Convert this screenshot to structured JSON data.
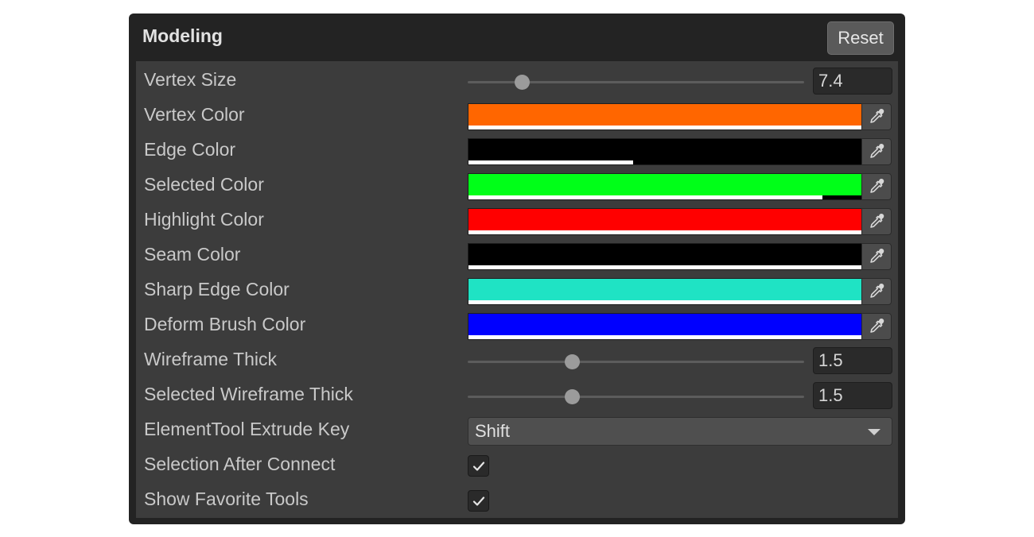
{
  "panel": {
    "title": "Modeling",
    "reset_label": "Reset"
  },
  "rows": [
    {
      "type": "slider",
      "label": "Vertex Size",
      "value": "7.4",
      "slider_fraction": 0.16
    },
    {
      "type": "color",
      "label": "Vertex Color",
      "color": "#ff6600",
      "alpha_fraction": 1.0
    },
    {
      "type": "color",
      "label": "Edge Color",
      "color": "#000000",
      "alpha_fraction": 0.42
    },
    {
      "type": "color",
      "label": "Selected Color",
      "color": "#00ff18",
      "alpha_fraction": 0.9
    },
    {
      "type": "color",
      "label": "Highlight Color",
      "color": "#ff0000",
      "alpha_fraction": 1.0
    },
    {
      "type": "color",
      "label": "Seam Color",
      "color": "#000000",
      "alpha_fraction": 1.0
    },
    {
      "type": "color",
      "label": "Sharp Edge Color",
      "color": "#1fe3c4",
      "alpha_fraction": 1.0
    },
    {
      "type": "color",
      "label": "Deform Brush Color",
      "color": "#0000ff",
      "alpha_fraction": 1.0
    },
    {
      "type": "slider",
      "label": "Wireframe Thick",
      "value": "1.5",
      "slider_fraction": 0.31
    },
    {
      "type": "slider",
      "label": "Selected Wireframe Thick",
      "value": "1.5",
      "slider_fraction": 0.31
    },
    {
      "type": "dropdown",
      "label": "ElementTool Extrude Key",
      "value": "Shift"
    },
    {
      "type": "checkbox",
      "label": "Selection After Connect",
      "checked": true
    },
    {
      "type": "checkbox",
      "label": "Show Favorite Tools",
      "checked": true
    }
  ],
  "icons": {
    "picker": "eyedropper-icon",
    "dropdown": "chevron-down-icon",
    "check": "checkmark-icon"
  }
}
